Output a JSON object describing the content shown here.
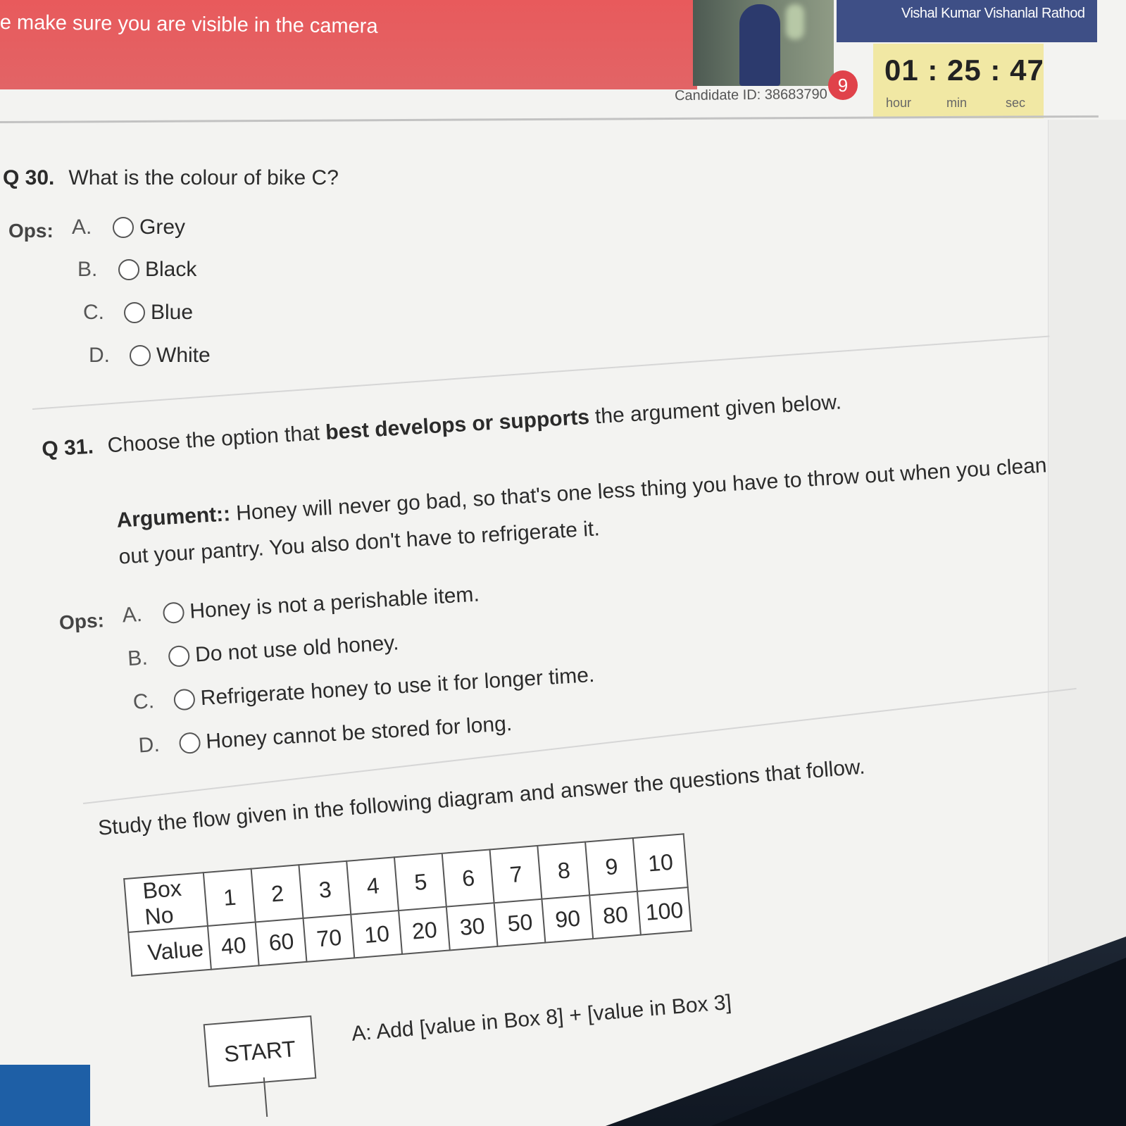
{
  "header": {
    "banner_text": "e make sure you are visible in the camera",
    "user_name": "Vishal Kumar Vishanlal Rathod",
    "candidate_id": "Candidate ID: 38683790",
    "pending_badge": "9",
    "timer": {
      "value": "01 : 25 : 47",
      "unit_hour": "hour",
      "unit_min": "min",
      "unit_sec": "sec"
    }
  },
  "q30": {
    "number": "Q 30.",
    "text": "What is the colour of bike C?",
    "ops_label": "Ops:",
    "options": [
      {
        "letter": "A.",
        "text": "Grey"
      },
      {
        "letter": "B.",
        "text": "Black"
      },
      {
        "letter": "C.",
        "text": "Blue"
      },
      {
        "letter": "D.",
        "text": "White"
      }
    ]
  },
  "q31": {
    "number": "Q 31.",
    "text_before": "Choose the option that ",
    "text_bold": "best develops or supports",
    "text_after": " the argument given below.",
    "argument_label": "Argument::",
    "argument_text": " Honey will never go bad, so that's one less thing you have to throw out when you clean out your pantry. You also don't have to refrigerate it.",
    "ops_label": "Ops:",
    "options": [
      {
        "letter": "A.",
        "text": "Honey is not a perishable item."
      },
      {
        "letter": "B.",
        "text": "Do not use old honey."
      },
      {
        "letter": "C.",
        "text": "Refrigerate honey to use it for longer time."
      },
      {
        "letter": "D.",
        "text": "Honey cannot be stored for long."
      }
    ]
  },
  "flow": {
    "instruction": "Study the flow given in the following diagram and answer the questions that follow.",
    "table": {
      "row1_label": "Box No",
      "row2_label": "Value",
      "boxes": [
        "1",
        "2",
        "3",
        "4",
        "5",
        "6",
        "7",
        "8",
        "9",
        "10"
      ],
      "values": [
        "40",
        "60",
        "70",
        "10",
        "20",
        "30",
        "50",
        "90",
        "80",
        "100"
      ]
    },
    "start_label": "START",
    "step_a": "A: Add [value in Box 8] + [value in Box 3]"
  },
  "colors": {
    "banner": "#e85a5c",
    "user_bar": "#3e4f86",
    "timer_bg": "#f1e8a4",
    "badge": "#e0424a"
  }
}
